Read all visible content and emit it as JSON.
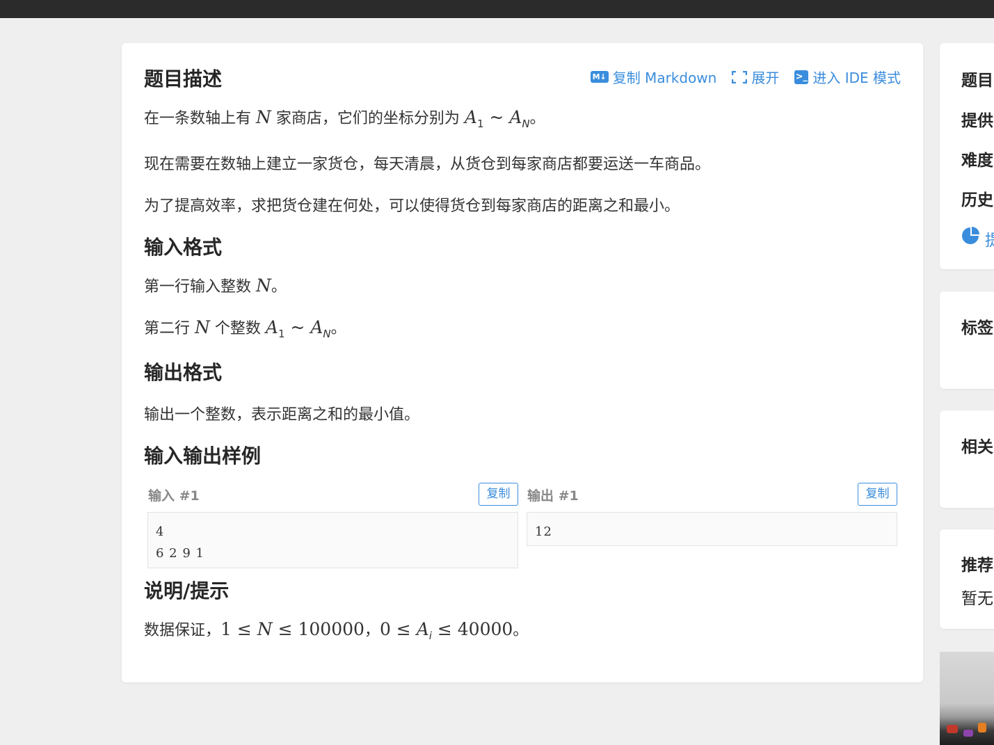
{
  "problem": {
    "section_description": "题目描述",
    "actions": {
      "copy_markdown": "复制 Markdown",
      "expand": "展开",
      "enter_ide": "进入 IDE 模式",
      "md_icon_text": "M↓",
      "ide_icon_text": ">_"
    },
    "desc_p1": {
      "before": "在一条数轴上有 ",
      "n": "N",
      "middle": " 家商店，它们的坐标分别为 ",
      "a": "A",
      "sub1": "1",
      "tilde": " ~ ",
      "a2": "A",
      "subN": "N",
      "end": "。"
    },
    "desc_p2": "现在需要在数轴上建立一家货仓，每天清晨，从货仓到每家商店都要运送一车商品。",
    "desc_p3": "为了提高效率，求把货仓建在何处，可以使得货仓到每家商店的距离之和最小。",
    "section_input": "输入格式",
    "input_p1": {
      "before": "第一行输入整数 ",
      "n": "N",
      "end": "。"
    },
    "input_p2": {
      "before": "第二行 ",
      "n": "N",
      "middle": " 个整数 ",
      "a": "A",
      "sub1": "1",
      "tilde": " ~ ",
      "a2": "A",
      "subN": "N",
      "end": "。"
    },
    "section_output": "输出格式",
    "output_p1": "输出一个整数，表示距离之和的最小值。",
    "section_samples": "输入输出样例",
    "sample_input_label": "输入 #1",
    "sample_output_label": "输出 #1",
    "copy_label": "复制",
    "sample_input": "4\n6 2 9 1",
    "sample_output": "12",
    "section_hint": "说明/提示",
    "hint": {
      "before": "数据保证，",
      "c1": "1 ≤ ",
      "n": "N",
      "c2": " ≤ 100000",
      "comma": "，",
      "c3": "0 ≤ ",
      "a": "A",
      "subi": "i",
      "c4": " ≤ 40000",
      "end": "。"
    }
  },
  "sidebar": {
    "info_card": {
      "item1": "题目",
      "item2": "提供",
      "item3": "难度",
      "item4": "历史",
      "item5": "提"
    },
    "tags_title": "标签",
    "related_title": "相关",
    "recommend_title": "推荐",
    "recommend_empty": "暂无"
  },
  "colors": {
    "accent": "#3a8ddc",
    "topbar": "#2b2b2b",
    "page_bg": "#efefef"
  }
}
